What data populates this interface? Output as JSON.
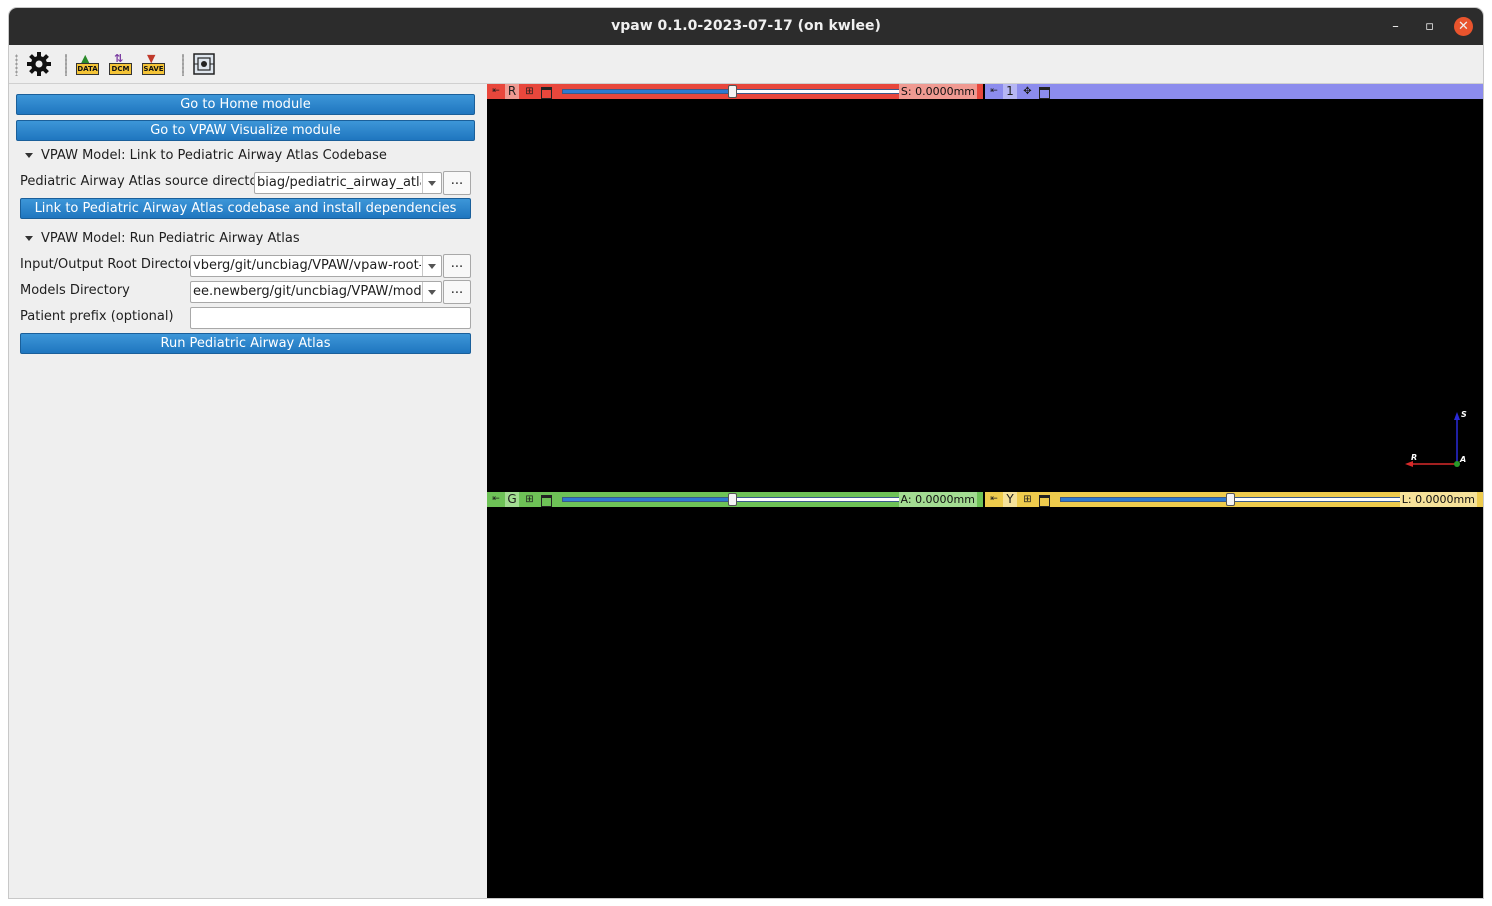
{
  "window": {
    "title": "vpaw 0.1.0-2023-07-17 (on kwlee)",
    "controls": {
      "minimize": "–",
      "maximize": "▫",
      "close": "✕"
    }
  },
  "toolbar": {
    "items": [
      {
        "name": "settings",
        "icon": "gear-icon"
      },
      {
        "name": "data",
        "label": "DATA",
        "icon": "load-data-icon"
      },
      {
        "name": "dcm",
        "label": "DCM",
        "icon": "dicom-icon"
      },
      {
        "name": "save",
        "label": "SAVE",
        "icon": "save-icon"
      },
      {
        "name": "extension",
        "icon": "extension-icon"
      }
    ]
  },
  "panel": {
    "home_button": "Go to Home module",
    "visualize_button": "Go to VPAW Visualize module",
    "section1": {
      "title": "VPAW Model: Link to Pediatric Airway Atlas Codebase",
      "source_label": "Pediatric Airway Atlas source directory",
      "source_value": "biag/pediatric_airway_atlas",
      "browse": "...",
      "link_button": "Link to Pediatric Airway Atlas codebase and install dependencies"
    },
    "section2": {
      "title": "VPAW Model: Run Pediatric Airway Atlas",
      "io_label": "Input/Output Root Directory",
      "io_value": "vberg/git/uncbiag/VPAW/vpaw-root-dir",
      "models_label": "Models Directory",
      "models_value": "ee.newberg/git/uncbiag/VPAW/models",
      "prefix_label": "Patient prefix (optional)",
      "prefix_value": "",
      "browse": "...",
      "run_button": "Run Pediatric Airway Atlas"
    }
  },
  "views": {
    "red": {
      "name": "R",
      "offset": "S: 0.0000mm",
      "slider_level": 0.5,
      "color": "#e8473c"
    },
    "threeD": {
      "name": "1",
      "color": "#8c8ced",
      "axes": {
        "s": "S",
        "r": "R",
        "a": "A"
      }
    },
    "green": {
      "name": "G",
      "offset": "A: 0.0000mm",
      "slider_level": 0.5,
      "color": "#6ec257"
    },
    "yellow": {
      "name": "Y",
      "offset": "L: 0.0000mm",
      "slider_level": 0.5,
      "color": "#eecb4d"
    }
  }
}
